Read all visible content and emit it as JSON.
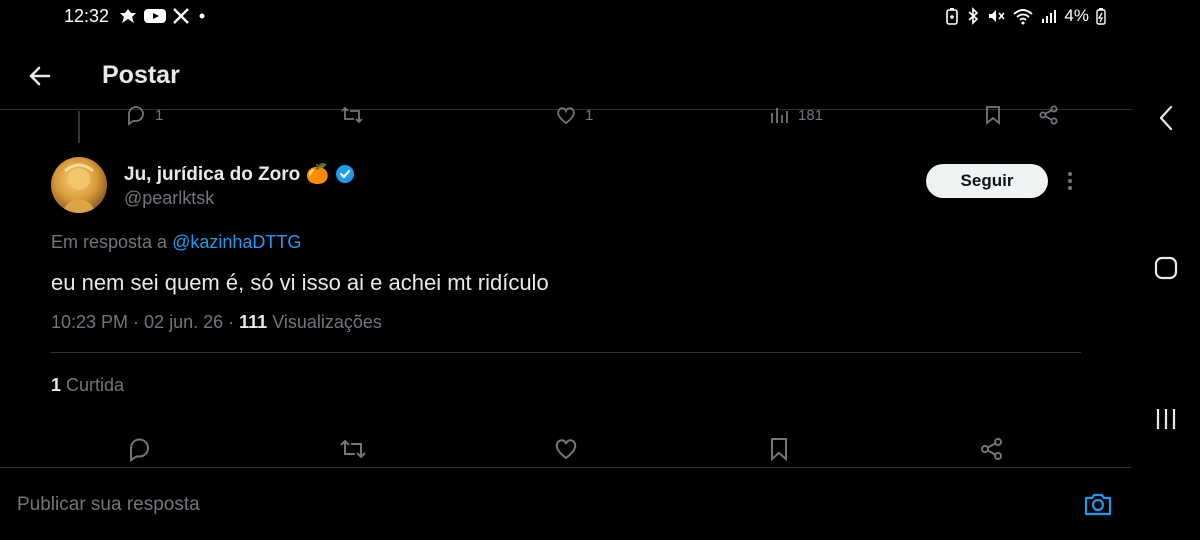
{
  "status_bar": {
    "time": "12:32",
    "battery": "4%",
    "left_icons": [
      "notification-icon",
      "youtube-icon",
      "x-logo-icon",
      "dot-icon"
    ],
    "right_icons": [
      "battery-saver-icon",
      "bluetooth-icon",
      "mute-icon",
      "wifi-icon",
      "signal-icon",
      "battery-icon"
    ]
  },
  "header": {
    "title": "Postar"
  },
  "previous_post_actions": {
    "reply_count": "1",
    "like_count": "1",
    "view_count": "181"
  },
  "post": {
    "author_name": "Ju, jurídica do Zoro 🍊",
    "handle": "@pearlktsk",
    "follow_label": "Seguir",
    "reply_prefix": "Em resposta a",
    "reply_handle": "@kazinhaDTTG",
    "text": "eu nem sei quem é, só vi isso ai e achei mt ridículo",
    "time": "10:23 PM",
    "date": "02 jun. 26",
    "views_count": "111",
    "views_label": "Visualizações",
    "likes_count": "1",
    "likes_label": "Curtida",
    "verified_color": "#1d9bf0"
  },
  "composer": {
    "placeholder": "Publicar sua resposta"
  },
  "colors": {
    "accent": "#1d9bf0",
    "background": "#000000",
    "muted": "#71767b",
    "text": "#e7e9ea"
  }
}
